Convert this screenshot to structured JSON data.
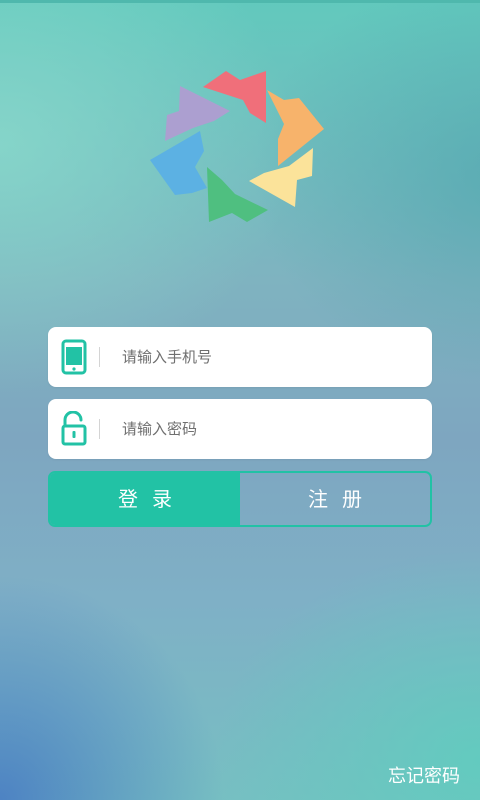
{
  "app": {
    "logo_name": "pinwheel-logo",
    "colors": {
      "accent": "#22c2a5",
      "logo_red": "#f06f7a",
      "logo_orange": "#f7b36b",
      "logo_yellow": "#fbe39a",
      "logo_green": "#4fbf80",
      "logo_blue": "#5cb1e3",
      "logo_purple": "#ac9fd0"
    }
  },
  "login_form": {
    "phone": {
      "icon": "smartphone-icon",
      "placeholder": "请输入手机号",
      "value": ""
    },
    "password": {
      "icon": "unlock-icon",
      "placeholder": "请输入密码",
      "value": ""
    },
    "login_label": "登录",
    "register_label": "注册"
  },
  "footer": {
    "forgot_password_label": "忘记密码"
  }
}
